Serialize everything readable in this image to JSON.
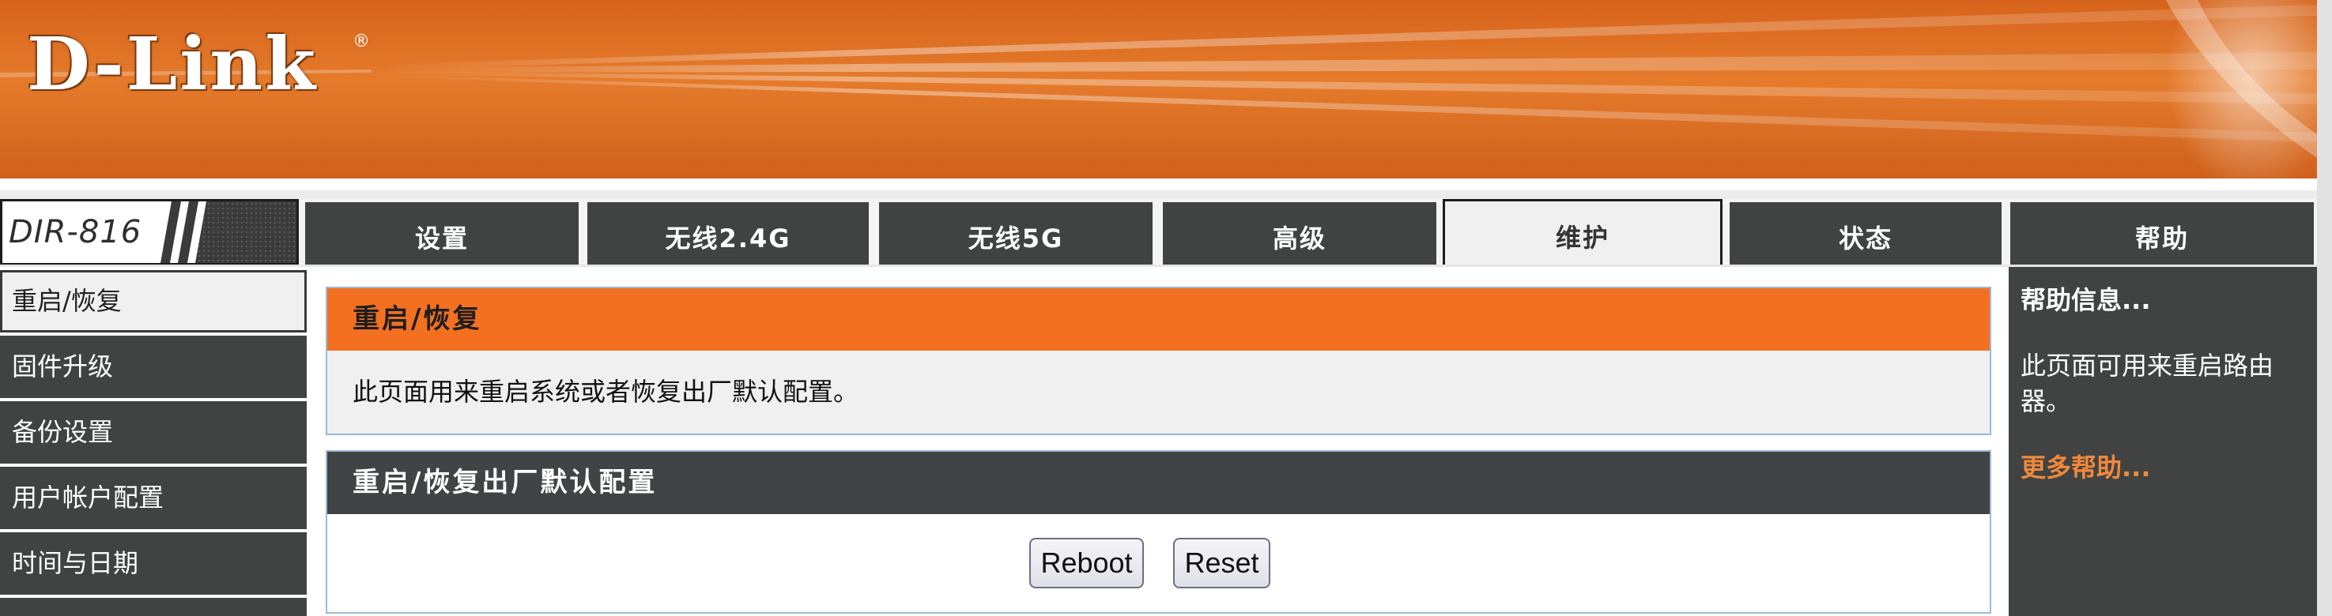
{
  "brand": {
    "logo": "D-Link",
    "reg": "®",
    "model": "DIR-816"
  },
  "tabs": [
    {
      "label": "设置"
    },
    {
      "label": "无线2.4G"
    },
    {
      "label": "无线5G"
    },
    {
      "label": "高级"
    },
    {
      "label": "维护",
      "active": true
    },
    {
      "label": "状态"
    },
    {
      "label": "帮助"
    }
  ],
  "sidebar": {
    "items": [
      {
        "label": "重启/恢复",
        "selected": true
      },
      {
        "label": "固件升级"
      },
      {
        "label": "备份设置"
      },
      {
        "label": "用户帐户配置"
      },
      {
        "label": "时间与日期"
      }
    ]
  },
  "main": {
    "intro": {
      "title": "重启/恢复",
      "text": "此页面用来重启系统或者恢复出厂默认配置。"
    },
    "factory": {
      "title": "重启/恢复出厂默认配置",
      "reboot_label": "Reboot",
      "reset_label": "Reset"
    }
  },
  "help": {
    "title": "帮助信息...",
    "text": "此页面可用来重启路由器。",
    "more": "更多帮助..."
  },
  "colors": {
    "banner_orange": "#e07428",
    "section_orange": "#f37021",
    "nav_dark": "#414343",
    "section_dark": "#404444",
    "more_help_orange": "#f0893b",
    "panel_border": "#9bb8d9"
  }
}
